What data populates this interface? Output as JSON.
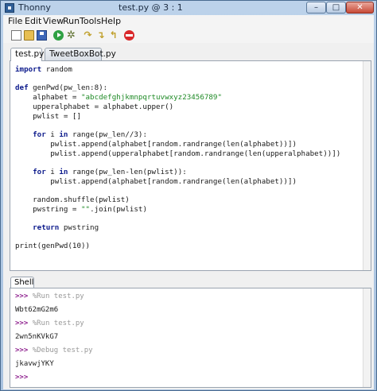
{
  "window": {
    "app_name": "Thonny",
    "file_title": "test.py  @  3 : 1",
    "minimize": "–",
    "maximize": "□",
    "close": "✕"
  },
  "menu": [
    "File",
    "Edit",
    "View",
    "Run",
    "Tools",
    "Help"
  ],
  "toolbar": {
    "new": "new-file",
    "open": "open-file",
    "save": "save-file",
    "run": "run",
    "debug": "debug",
    "step_over": "step-over",
    "step_into": "step-into",
    "step_out": "step-out",
    "stop": "stop"
  },
  "tabs": [
    {
      "label": "test.py",
      "active": true
    },
    {
      "label": "TweetBoxBot.py",
      "active": false
    }
  ],
  "code": {
    "l1_kw": "import",
    "l1": " random",
    "l2_kw": "def",
    "l2": " genPwd(pw_len:8):",
    "l3": "    alphabet = ",
    "l3_str": "\"abcdefghjkmnpqrtuvwxyz23456789\"",
    "l4": "    upperalphabet = alphabet.upper()",
    "l5": "    pwlist = []",
    "l6_kw": "    for",
    "l6a": " i ",
    "l6_kw2": "in",
    "l6b": " range(pw_len//3):",
    "l7": "        pwlist.append(alphabet[random.randrange(len(alphabet))])",
    "l8": "        pwlist.append(upperalphabet[random.randrange(len(upperalphabet))])",
    "l9_kw": "    for",
    "l9a": " i ",
    "l9_kw2": "in",
    "l9b": " range(pw_len-len(pwlist)):",
    "l10": "        pwlist.append(alphabet[random.randrange(len(alphabet))])",
    "l11": "    random.shuffle(pwlist)",
    "l12a": "    pwstring = ",
    "l12_str": "\"\"",
    "l12b": ".join(pwlist)",
    "l13_kw": "    return",
    "l13": " pwstring",
    "l14": "print(genPwd(10))"
  },
  "shell": {
    "tab": "Shell",
    "prompt": ">>>",
    "entries": [
      {
        "cmd": "%Run test.py",
        "out": "Wbt62mG2m6"
      },
      {
        "cmd": "%Run test.py",
        "out": "2wn5nKVkG7"
      },
      {
        "cmd": "%Debug test.py",
        "out": "jkavwjYKY"
      }
    ]
  }
}
